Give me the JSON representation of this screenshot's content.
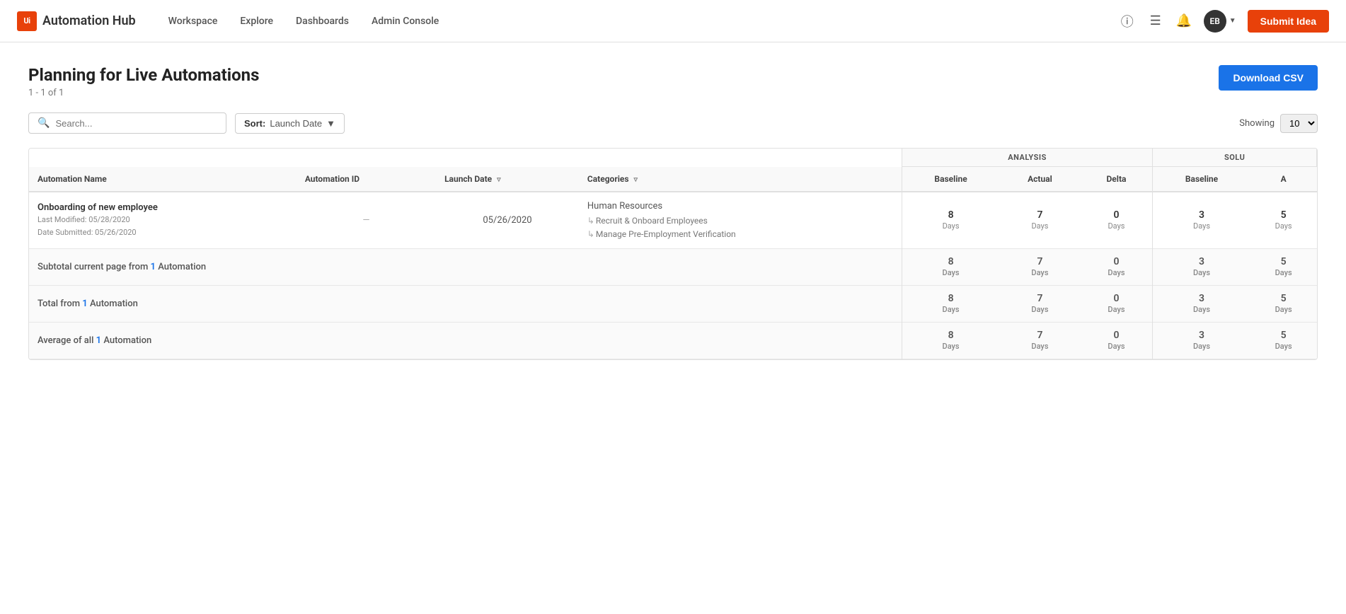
{
  "header": {
    "logo_text": "Automation Hub",
    "logo_icon": "Ui",
    "nav": [
      {
        "label": "Workspace",
        "id": "workspace"
      },
      {
        "label": "Explore",
        "id": "explore"
      },
      {
        "label": "Dashboards",
        "id": "dashboards"
      },
      {
        "label": "Admin Console",
        "id": "admin-console"
      }
    ],
    "submit_idea_label": "Submit Idea",
    "user_initials": "EB"
  },
  "page": {
    "title": "Planning for Live Automations",
    "subtitle": "1 - 1 of 1",
    "download_csv_label": "Download CSV"
  },
  "filters": {
    "search_placeholder": "Search...",
    "sort_label": "Sort:",
    "sort_value": "Launch Date",
    "showing_label": "Showing",
    "showing_value": "10"
  },
  "table": {
    "group_headers": [
      {
        "label": "ANALYSIS",
        "colspan": 3
      },
      {
        "label": "SOLU",
        "colspan": 2
      }
    ],
    "columns": [
      {
        "label": "Automation Name",
        "id": "name"
      },
      {
        "label": "Automation ID",
        "id": "id"
      },
      {
        "label": "Launch Date",
        "id": "launch_date",
        "filter": true
      },
      {
        "label": "Categories",
        "id": "categories",
        "filter": true
      },
      {
        "label": "Baseline",
        "id": "analysis_baseline"
      },
      {
        "label": "Actual",
        "id": "analysis_actual"
      },
      {
        "label": "Delta",
        "id": "analysis_delta"
      },
      {
        "label": "Baseline",
        "id": "solution_baseline"
      },
      {
        "label": "A",
        "id": "solution_a"
      }
    ],
    "rows": [
      {
        "name": "Onboarding of new employee",
        "last_modified": "Last Modified: 05/28/2020",
        "date_submitted": "Date Submitted: 05/26/2020",
        "id": "—",
        "launch_date": "05/26/2020",
        "categories": "Human Resources",
        "sub_categories": [
          "Recruit & Onboard Employees",
          "Manage Pre-Employment Verification"
        ],
        "analysis_baseline": "8",
        "analysis_baseline_unit": "Days",
        "analysis_actual": "7",
        "analysis_actual_unit": "Days",
        "analysis_delta": "0",
        "analysis_delta_unit": "Days",
        "solution_baseline": "3",
        "solution_baseline_unit": "Days",
        "solution_a": "5",
        "solution_a_unit": "Days"
      }
    ],
    "subtotal": {
      "label": "Subtotal current page from",
      "count": "1",
      "count_label": "Automation",
      "analysis_baseline": "8",
      "analysis_baseline_unit": "Days",
      "analysis_actual": "7",
      "analysis_actual_unit": "Days",
      "analysis_delta": "0",
      "analysis_delta_unit": "Days",
      "solution_baseline": "3",
      "solution_baseline_unit": "Days",
      "solution_a": "5",
      "solution_a_unit": "Days"
    },
    "total": {
      "label": "Total from",
      "count": "1",
      "count_label": "Automation",
      "analysis_baseline": "8",
      "analysis_baseline_unit": "Days",
      "analysis_actual": "7",
      "analysis_actual_unit": "Days",
      "analysis_delta": "0",
      "analysis_delta_unit": "Days",
      "solution_baseline": "3",
      "solution_baseline_unit": "Days",
      "solution_a": "5",
      "solution_a_unit": "Days"
    },
    "average": {
      "label": "Average of all",
      "count": "1",
      "count_label": "Automation",
      "analysis_baseline": "8",
      "analysis_baseline_unit": "Days",
      "analysis_actual": "7",
      "analysis_actual_unit": "Days",
      "analysis_delta": "0",
      "analysis_delta_unit": "Days",
      "solution_baseline": "3",
      "solution_baseline_unit": "Days",
      "solution_a": "5",
      "solution_a_unit": "Days"
    }
  }
}
